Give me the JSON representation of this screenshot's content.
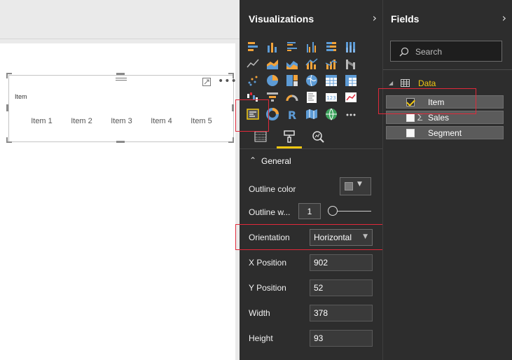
{
  "slicer": {
    "title": "Item",
    "items": [
      "Item 1",
      "Item 2",
      "Item 3",
      "Item 4",
      "Item 5"
    ]
  },
  "visualizations": {
    "title": "Visualizations",
    "tabs": [
      "fields-icon",
      "format-paint-icon",
      "analytics-icon"
    ],
    "active_tab": "format-paint-icon",
    "section": "General",
    "props": {
      "outline_color_label": "Outline color",
      "outline_weight_label": "Outline w...",
      "outline_weight_value": "1",
      "orientation_label": "Orientation",
      "orientation_value": "Horizontal",
      "x_label": "X Position",
      "x_value": "902",
      "y_label": "Y Position",
      "y_value": "52",
      "width_label": "Width",
      "width_value": "378",
      "height_label": "Height",
      "height_value": "93"
    }
  },
  "fields": {
    "title": "Fields",
    "search_placeholder": "Search",
    "table_name": "Data",
    "items": [
      {
        "name": "Item",
        "checked": true,
        "sigma": false
      },
      {
        "name": "Sales",
        "checked": false,
        "sigma": true
      },
      {
        "name": "Segment",
        "checked": false,
        "sigma": false
      }
    ]
  },
  "colors": {
    "accent": "#f2c811",
    "highlight_border": "#e0293a",
    "pane_bg": "#2d2d2d"
  }
}
